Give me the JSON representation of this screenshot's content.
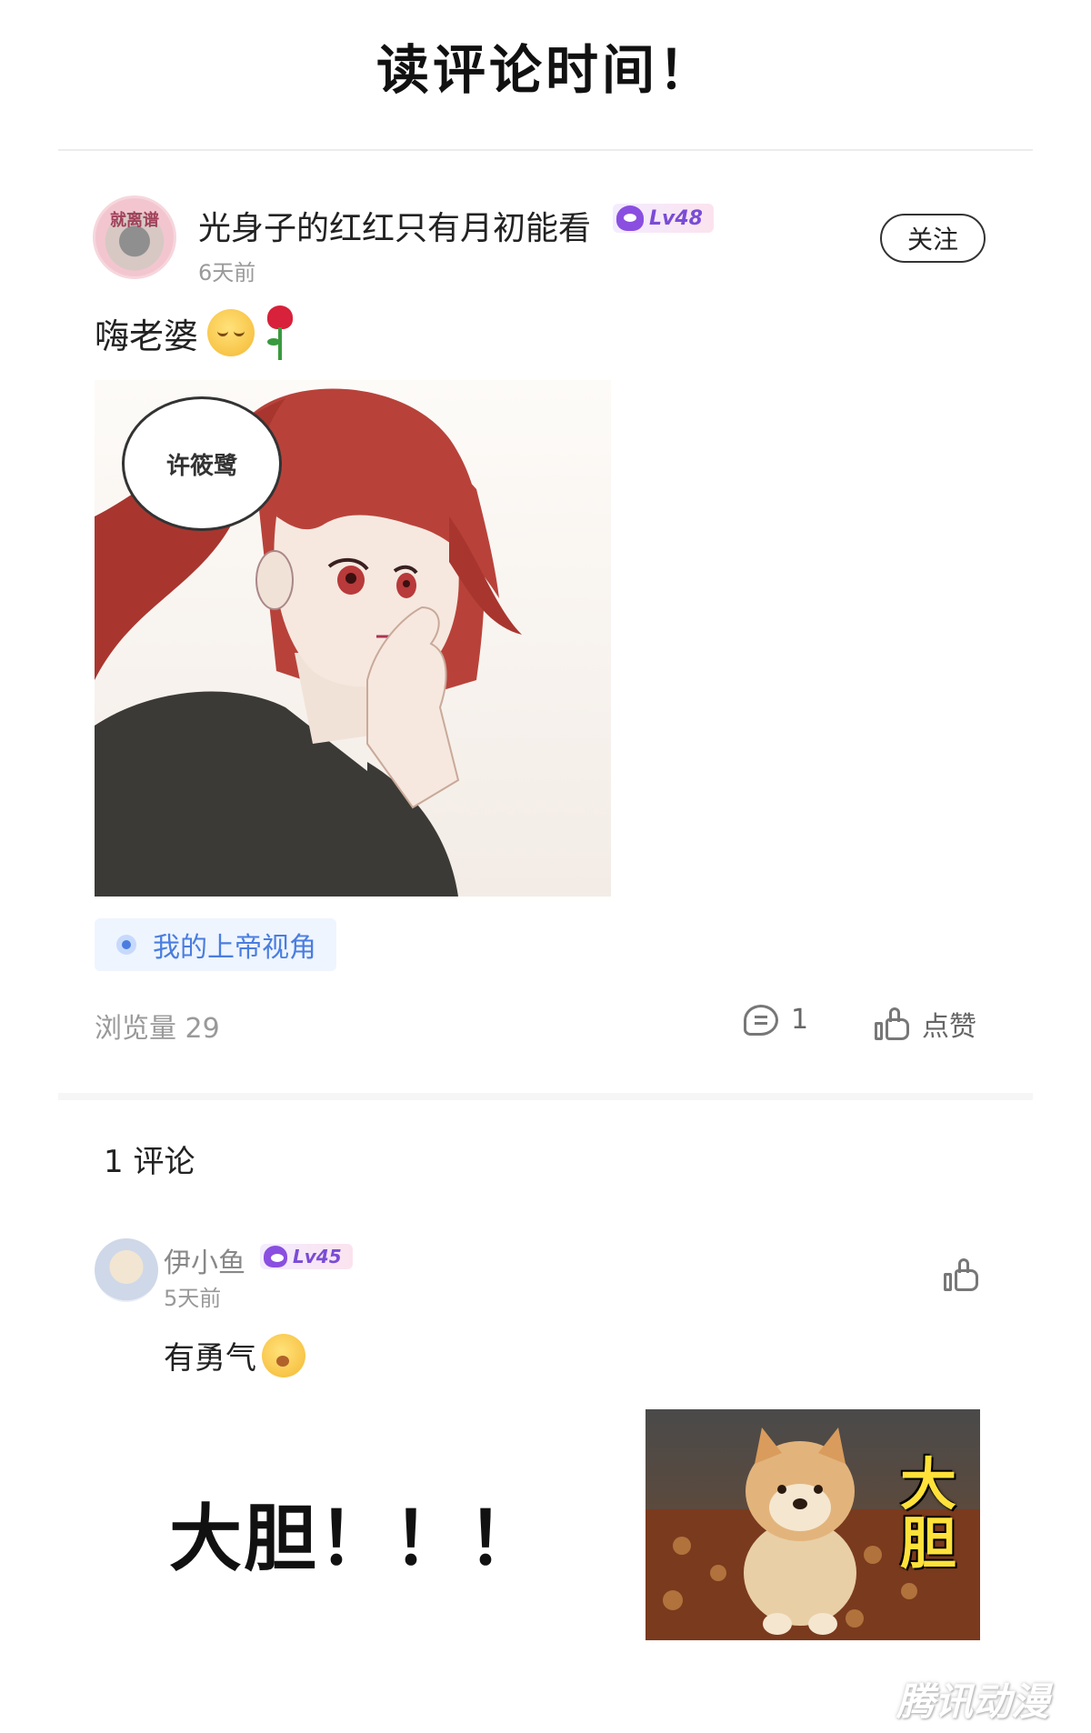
{
  "page_title": "读评论时间！",
  "post": {
    "avatar_text": "就离谱",
    "username": "光身子的红红只有月初能看",
    "level": "Lv48",
    "time": "6天前",
    "follow_label": "关注",
    "text": "嗨老婆",
    "image": {
      "speech_bubble": "许筱鹭"
    },
    "topic": "我的上帝视角",
    "views_label": "浏览量 29",
    "comment_count": "1",
    "like_label": "点赞"
  },
  "comments_section": {
    "title": "1 评论",
    "items": [
      {
        "username": "伊小鱼",
        "level": "Lv45",
        "time": "5天前",
        "text": "有勇气"
      }
    ]
  },
  "reply_overlay": {
    "big_text": "大胆！！！",
    "sticker_caption": "大胆"
  },
  "watermark": "腾讯动漫",
  "colors": {
    "level_purple": "#7a4cd6",
    "topic_blue": "#4a7de0",
    "hair_red": "#b8423a"
  },
  "icons": {
    "level": "level-badge-icon",
    "comment": "comment-bubble-icon",
    "like": "thumbs-up-icon",
    "topic": "topic-dot-icon"
  }
}
